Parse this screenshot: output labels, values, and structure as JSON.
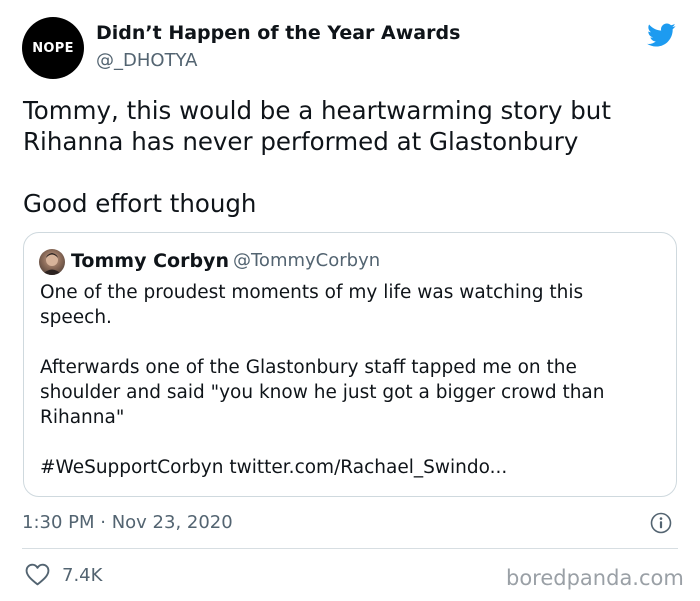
{
  "author": {
    "avatar_text": "NOPE",
    "display_name": "Didn’t Happen of the Year Awards",
    "handle": "@_DHOTYA"
  },
  "tweet": {
    "paragraphs": [
      "Tommy, this would be a heartwarming story but",
      "Rihanna has never performed at Glastonbury",
      "",
      "Good effort though"
    ]
  },
  "quoted_tweet": {
    "display_name": "Tommy Corbyn",
    "handle": "@TommyCorbyn",
    "lines": [
      "One of the proudest moments of my life was watching this",
      "speech.",
      "",
      "Afterwards one of the Glastonbury staff tapped me on the",
      "shoulder and said \"you know he just got a bigger crowd than",
      "Rihanna\"",
      "",
      "#WeSupportCorbyn twitter.com/Rachael_Swindo..."
    ]
  },
  "meta": {
    "timestamp": "1:30 PM · Nov 23, 2020",
    "like_count": "7.4K"
  },
  "watermark": "boredpanda.com",
  "icons": {
    "brand": "twitter-bird-icon",
    "info": "info-icon",
    "like": "heart-icon"
  },
  "colors": {
    "twitter_blue": "#1d9bf0",
    "secondary_text": "#536471",
    "primary_text": "#0f1419",
    "card_border": "#cfd9de"
  }
}
